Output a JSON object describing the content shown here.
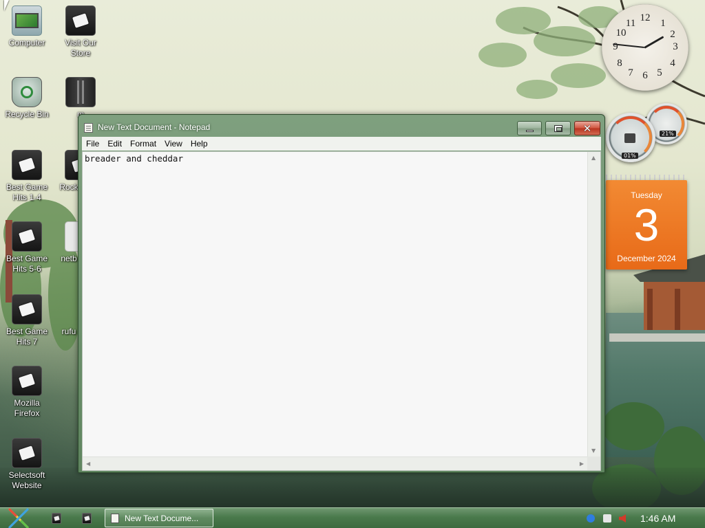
{
  "desktop": {
    "icons": [
      {
        "label": "Computer",
        "icon": "computer-icon"
      },
      {
        "label": "Visit Our Store",
        "icon": "shortcut-icon"
      },
      {
        "label": "Recycle Bin",
        "icon": "recycle-bin-icon"
      },
      {
        "label": "m",
        "icon": "book-icon"
      },
      {
        "label": "Best Game Hits 1-4",
        "icon": "shortcut-icon"
      },
      {
        "label": "Rock",
        "icon": "shortcut-icon"
      },
      {
        "label": "Best Game Hits 5-6",
        "icon": "shortcut-icon"
      },
      {
        "label": "netb",
        "icon": "shortcut-icon"
      },
      {
        "label": "Best Game Hits 7",
        "icon": "shortcut-icon"
      },
      {
        "label": "rufu",
        "icon": "shortcut-icon"
      },
      {
        "label": "Mozilla Firefox",
        "icon": "shortcut-icon"
      },
      {
        "label": "Selectsoft Website",
        "icon": "shortcut-icon"
      }
    ]
  },
  "notepad": {
    "title": "New Text Document - Notepad",
    "menu": [
      "File",
      "Edit",
      "Format",
      "View",
      "Help"
    ],
    "content": "breader and cheddar"
  },
  "clock_gadget": {
    "numbers": [
      "12",
      "1",
      "2",
      "3",
      "4",
      "5",
      "6",
      "7",
      "8",
      "9",
      "10",
      "11"
    ],
    "time_shown": "1:46"
  },
  "meter_gadget": {
    "cpu_percent": "01%",
    "memory_percent": "21%"
  },
  "calendar_gadget": {
    "weekday": "Tuesday",
    "day": "3",
    "month_year": "December 2024"
  },
  "taskbar": {
    "task_label": "New Text Docume...",
    "time": "1:46 AM"
  },
  "colors": {
    "window_frame": "#6a8f6a",
    "taskbar": "#4a7a4c",
    "calendar": "#ec7625",
    "close_button": "#c8452d"
  }
}
